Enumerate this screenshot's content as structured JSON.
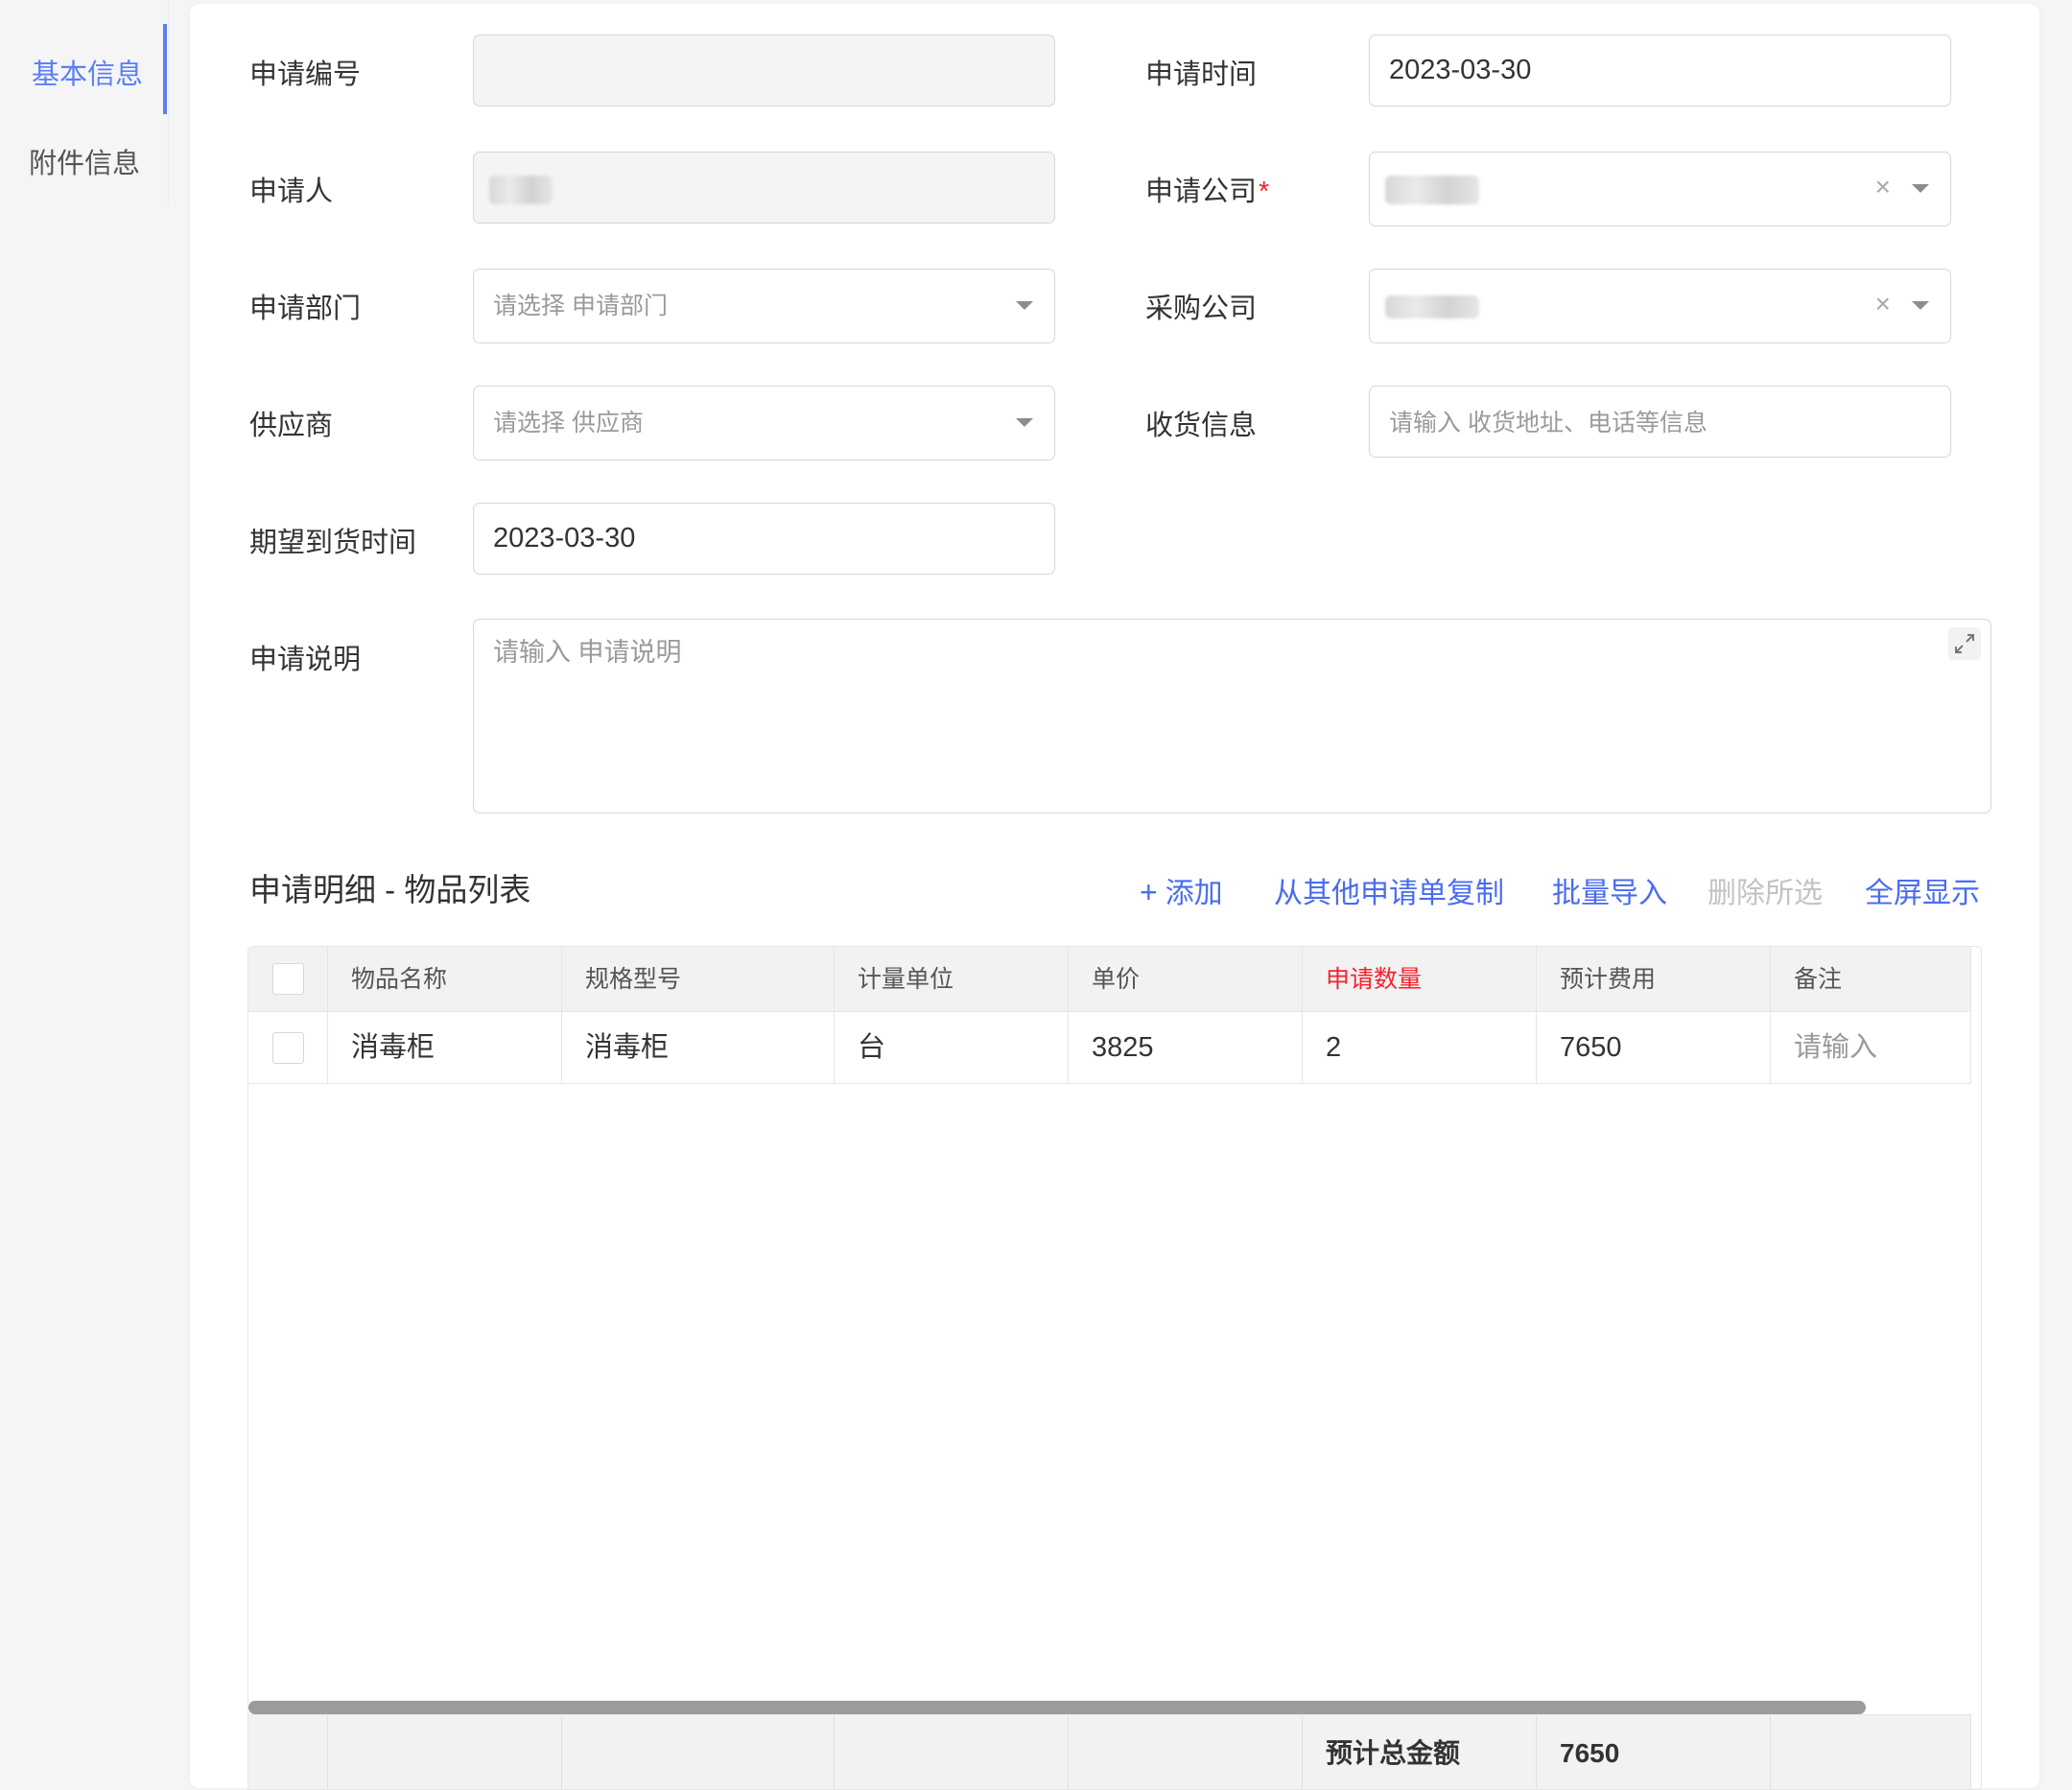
{
  "anchor_nav": {
    "items": [
      {
        "label": "基本信息"
      },
      {
        "label": "附件信息"
      }
    ]
  },
  "form": {
    "apply_no": {
      "label": "申请编号",
      "value": ""
    },
    "apply_time": {
      "label": "申请时间",
      "value": "2023-03-30"
    },
    "applicant": {
      "label": "申请人"
    },
    "apply_company": {
      "label": "申请公司",
      "required_mark": "*"
    },
    "apply_dept": {
      "label": "申请部门",
      "placeholder": "请选择 申请部门"
    },
    "purchase_company": {
      "label": "采购公司"
    },
    "supplier": {
      "label": "供应商",
      "placeholder": "请选择 供应商"
    },
    "receive_info": {
      "label": "收货信息",
      "placeholder": "请输入 收货地址、电话等信息"
    },
    "expected_arrival": {
      "label": "期望到货时间",
      "value": "2023-03-30"
    },
    "apply_desc": {
      "label": "申请说明",
      "placeholder": "请输入 申请说明"
    }
  },
  "detail": {
    "title": "申请明细 - 物品列表",
    "actions": {
      "add": "添加",
      "copy_from_other": "从其他申请单复制",
      "batch_import": "批量导入",
      "delete_selected": "删除所选",
      "fullscreen": "全屏显示"
    },
    "columns": [
      "物品名称",
      "规格型号",
      "计量单位",
      "单价",
      "申请数量",
      "预计费用",
      "备注"
    ],
    "rows": [
      {
        "name": "消毒柜",
        "spec": "消毒柜",
        "unit": "台",
        "price": "3825",
        "qty": "2",
        "cost": "7650",
        "remark_placeholder": "请输入"
      }
    ],
    "footer": {
      "total_label": "预计总金额",
      "total_value": "7650"
    }
  },
  "icons": {
    "add": "plus-icon",
    "select": "chevron-down-icon",
    "clear": "close-icon",
    "expand": "expand-icon"
  },
  "colors": {
    "accent": "#4a6cf0",
    "required": "#f5222d",
    "disabled_text": "#c3c3c3"
  }
}
